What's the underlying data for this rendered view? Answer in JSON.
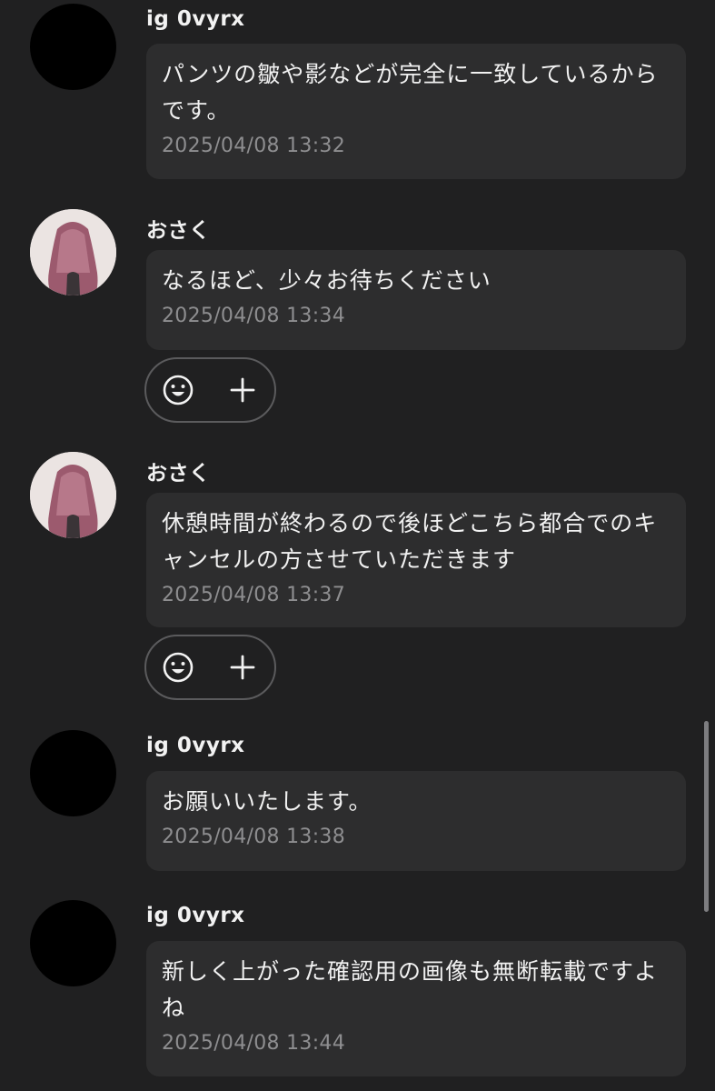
{
  "messages": [
    {
      "sender": "ig 0vyrx",
      "avatar": "black-avatar",
      "text": "パンツの皺や影などが完全に一致しているからです。",
      "time": "2025/04/08 13:32"
    },
    {
      "sender": "おさく",
      "avatar": "photo-avatar",
      "text": "なるほど、少々お待ちください",
      "time": "2025/04/08 13:34"
    },
    {
      "sender": "おさく",
      "avatar": "photo-avatar",
      "text": "休憩時間が終わるので後ほどこちら都合でのキャンセルの方させていただきます",
      "time": "2025/04/08 13:37"
    },
    {
      "sender": "ig 0vyrx",
      "avatar": "black-avatar",
      "text": "お願いいたします。",
      "time": "2025/04/08 13:38"
    },
    {
      "sender": "ig 0vyrx",
      "avatar": "black-avatar",
      "text": "新しく上がった確認用の画像も無断転載ですよね",
      "time": "2025/04/08 13:44"
    }
  ],
  "reaction_bar": {
    "emoji_icon": "smiley-face-icon",
    "add_icon": "plus-icon"
  },
  "colors": {
    "background": "#202021",
    "bubble": "#2d2d2e",
    "text": "#f1f1f1",
    "timestamp": "#8e8e90"
  }
}
